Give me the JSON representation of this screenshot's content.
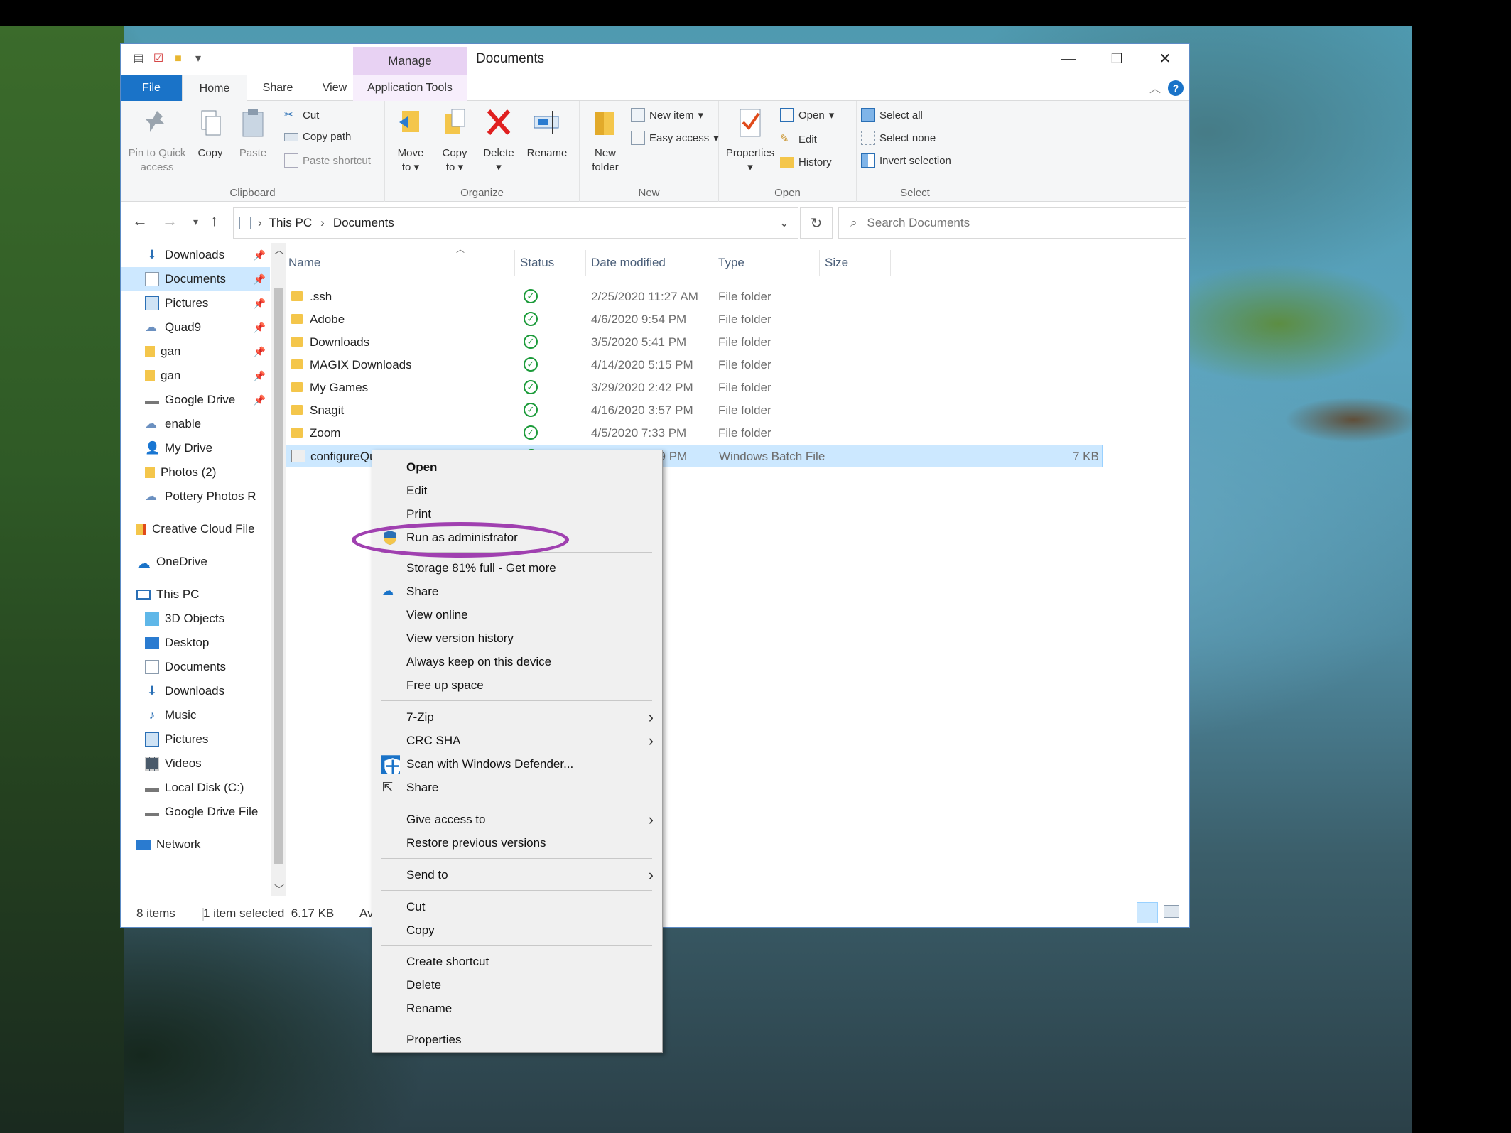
{
  "window": {
    "title": "Documents",
    "manage_tab": "Manage"
  },
  "tabs": {
    "file": "File",
    "home": "Home",
    "share": "Share",
    "view": "View",
    "application_tools": "Application Tools"
  },
  "ribbon": {
    "clipboard": {
      "label": "Clipboard",
      "pin_line1": "Pin to Quick",
      "pin_line2": "access",
      "copy": "Copy",
      "paste": "Paste",
      "cut": "Cut",
      "copy_path": "Copy path",
      "paste_shortcut": "Paste shortcut"
    },
    "organize": {
      "label": "Organize",
      "move_line1": "Move",
      "move_line2": "to",
      "copy_line1": "Copy",
      "copy_line2": "to",
      "delete": "Delete",
      "rename": "Rename"
    },
    "new": {
      "label": "New",
      "new_folder_line1": "New",
      "new_folder_line2": "folder",
      "new_item": "New item",
      "easy_access": "Easy access"
    },
    "open": {
      "label": "Open",
      "properties": "Properties",
      "open": "Open",
      "edit": "Edit",
      "history": "History"
    },
    "select": {
      "label": "Select",
      "select_all": "Select all",
      "select_none": "Select none",
      "invert_selection": "Invert selection"
    }
  },
  "address": {
    "crumbs": [
      "This PC",
      "Documents"
    ],
    "search_placeholder": "Search Documents"
  },
  "nav": {
    "items": [
      {
        "label": "Downloads",
        "pinned": true
      },
      {
        "label": "Documents",
        "pinned": true
      },
      {
        "label": "Pictures",
        "pinned": true
      },
      {
        "label": "Quad9",
        "pinned": true
      },
      {
        "label": "gan",
        "pinned": true
      },
      {
        "label": "gan",
        "pinned": true
      },
      {
        "label": "Google Drive",
        "pinned": true
      },
      {
        "label": "enable"
      },
      {
        "label": "My Drive"
      },
      {
        "label": "Photos (2)"
      },
      {
        "label": "Pottery Photos R"
      },
      {
        "label": "Creative Cloud File"
      },
      {
        "label": "OneDrive"
      },
      {
        "label": "This PC"
      },
      {
        "label": "3D Objects"
      },
      {
        "label": "Desktop"
      },
      {
        "label": "Documents"
      },
      {
        "label": "Downloads"
      },
      {
        "label": "Music"
      },
      {
        "label": "Pictures"
      },
      {
        "label": "Videos"
      },
      {
        "label": "Local Disk (C:)"
      },
      {
        "label": "Google Drive File"
      },
      {
        "label": "Network"
      }
    ]
  },
  "filelist": {
    "columns": {
      "name": "Name",
      "status": "Status",
      "date": "Date modified",
      "type": "Type",
      "size": "Size"
    },
    "rows": [
      {
        "name": ".ssh",
        "date": "2/25/2020 11:27 AM",
        "type": "File folder",
        "size": ""
      },
      {
        "name": "Adobe",
        "date": "4/6/2020 9:54 PM",
        "type": "File folder",
        "size": ""
      },
      {
        "name": "Downloads",
        "date": "3/5/2020 5:41 PM",
        "type": "File folder",
        "size": ""
      },
      {
        "name": "MAGIX Downloads",
        "date": "4/14/2020 5:15 PM",
        "type": "File folder",
        "size": ""
      },
      {
        "name": "My Games",
        "date": "3/29/2020 2:42 PM",
        "type": "File folder",
        "size": ""
      },
      {
        "name": "Snagit",
        "date": "4/16/2020 3:57 PM",
        "type": "File folder",
        "size": ""
      },
      {
        "name": "Zoom",
        "date": "4/5/2020 7:33 PM",
        "type": "File folder",
        "size": ""
      },
      {
        "name": "configureQuad9",
        "date": "4/8/2020 1:19 PM",
        "type": "Windows Batch File",
        "size": "7 KB"
      }
    ]
  },
  "statusbar": {
    "items": "8 items",
    "selected": "1 item selected  6.17 KB",
    "avail": "Av"
  },
  "context_menu": {
    "open": "Open",
    "edit": "Edit",
    "print": "Print",
    "run_as_admin": "Run as administrator",
    "storage": "Storage 81% full - Get more",
    "share_onedrive": "Share",
    "view_online": "View online",
    "view_version_history": "View version history",
    "always_keep": "Always keep on this device",
    "free_up": "Free up space",
    "seven_zip": "7-Zip",
    "crc_sha": "CRC SHA",
    "scan_defender": "Scan with Windows Defender...",
    "share": "Share",
    "give_access": "Give access to",
    "restore": "Restore previous versions",
    "send_to": "Send to",
    "cut": "Cut",
    "copy": "Copy",
    "create_shortcut": "Create shortcut",
    "delete": "Delete",
    "rename": "Rename",
    "properties": "Properties"
  },
  "colors": {
    "accent": "#1a73c8",
    "selection": "#cce8ff",
    "highlight_ring": "#a040b0",
    "sync_ok": "#1c9b3a",
    "manage_tab": "#e8d2f3"
  }
}
